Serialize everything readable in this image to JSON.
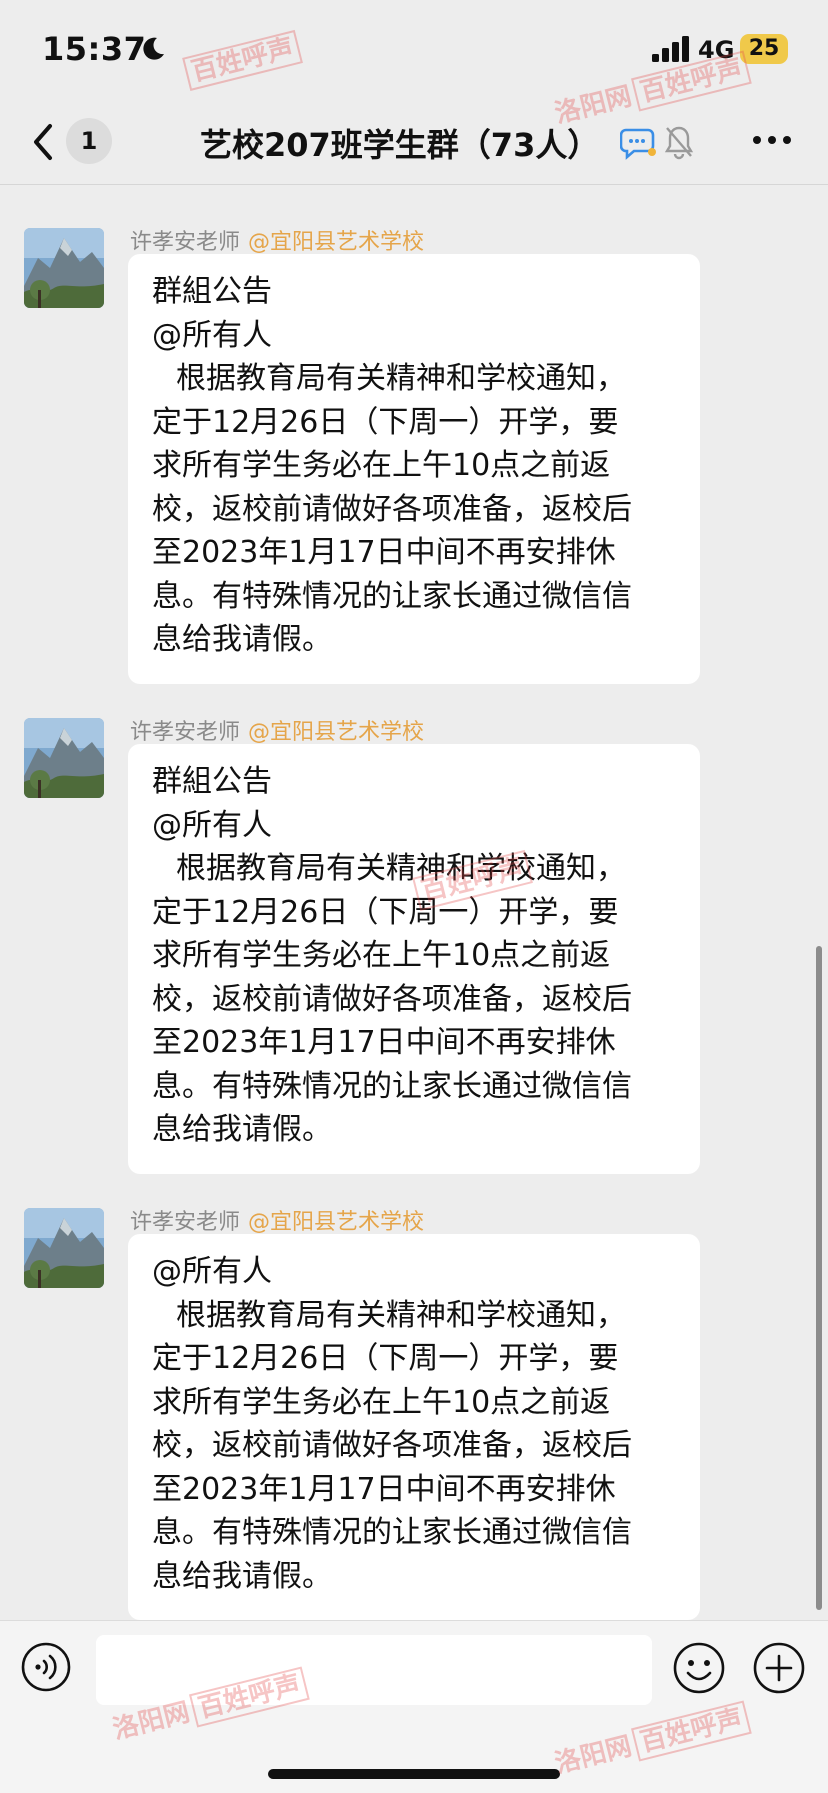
{
  "status_bar": {
    "time": "15:37",
    "network": "4G",
    "battery": "25",
    "icons": [
      "moon-icon",
      "signal-icon"
    ]
  },
  "nav": {
    "unread_count": "1",
    "title": "艺校207班学生群（73人）",
    "icons": [
      "back-icon",
      "chat-status-icon",
      "mute-icon",
      "more-icon"
    ]
  },
  "messages": [
    {
      "sender": "许孝安老师",
      "org": "@宜阳县艺术学校",
      "lines": [
        "群組公告",
        "@所有人",
        "根据教育局有关精神和学校通知，",
        "定于12月26日（下周一）开学，要",
        "求所有学生务必在上午10点之前返",
        "校，返校前请做好各项准备，返校后",
        "至2023年1月17日中间不再安排休",
        "息。有特殊情况的让家长通过微信信",
        "息给我请假。"
      ]
    },
    {
      "sender": "许孝安老师",
      "org": "@宜阳县艺术学校",
      "lines": [
        "群組公告",
        "@所有人",
        "根据教育局有关精神和学校通知，",
        "定于12月26日（下周一）开学，要",
        "求所有学生务必在上午10点之前返",
        "校，返校前请做好各项准备，返校后",
        "至2023年1月17日中间不再安排休",
        "息。有特殊情况的让家长通过微信信",
        "息给我请假。"
      ]
    },
    {
      "sender": "许孝安老师",
      "org": "@宜阳县艺术学校",
      "lines": [
        "@所有人",
        "根据教育局有关精神和学校通知，",
        "定于12月26日（下周一）开学，要",
        "求所有学生务必在上午10点之前返",
        "校，返校前请做好各项准备，返校后",
        "至2023年1月17日中间不再安排休",
        "息。有特殊情况的让家长通过微信信",
        "息给我请假。"
      ]
    }
  ],
  "input_bar": {
    "icons": [
      "voice-icon",
      "emoji-icon",
      "plus-icon"
    ]
  },
  "watermark": {
    "site": "洛阳网",
    "column": "百姓呼声"
  },
  "colors": {
    "background": "#ededed",
    "bubble": "#ffffff",
    "org_tag": "#e5a54a",
    "sender": "#8a8a8a",
    "battery": "#f0c94a",
    "watermark": "#e24a4a"
  }
}
